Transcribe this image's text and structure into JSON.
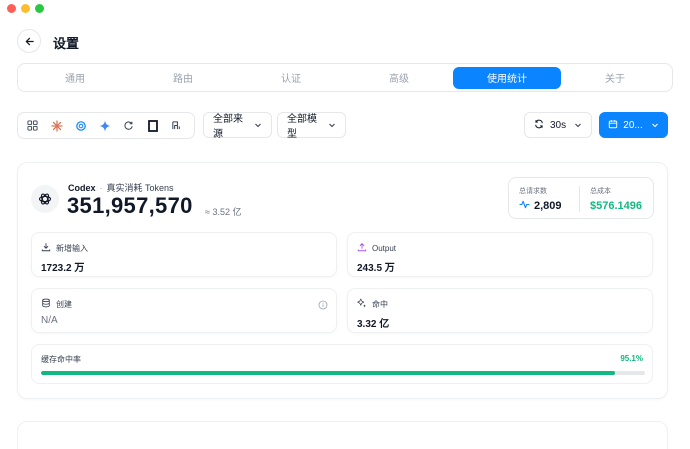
{
  "window": {
    "title": "设置"
  },
  "tabs": [
    {
      "label": "通用",
      "active": false
    },
    {
      "label": "路由",
      "active": false
    },
    {
      "label": "认证",
      "active": false
    },
    {
      "label": "高级",
      "active": false
    },
    {
      "label": "使用统计",
      "active": true
    },
    {
      "label": "关于",
      "active": false
    }
  ],
  "filters": {
    "source_icons": [
      "grid-icon",
      "claude-icon",
      "openai-icon",
      "gemini-icon",
      "refresh-ring-icon",
      "square-logo-icon",
      "pi-icon"
    ],
    "source": "全部来源",
    "model": "全部模型",
    "refresh": "30s",
    "date": "20..."
  },
  "stats": {
    "app_name": "Codex",
    "subtitle": "真实消耗 Tokens",
    "total_tokens": "351,957,570",
    "approx": "≈ 3.52 亿",
    "summary": {
      "requests_label": "总请求数",
      "requests_value": "2,809",
      "cost_label": "总成本",
      "cost_value": "$576.1496"
    },
    "metrics": {
      "input_label": "新增输入",
      "input_value": "1723.2 万",
      "output_label": "Output",
      "output_value": "243.5 万",
      "create_label": "创建",
      "create_value": "N/A",
      "hit_label": "命中",
      "hit_value": "3.32 亿"
    },
    "cache_hit": {
      "label": "缓存命中率",
      "percent_text": "95.1%",
      "fraction": 0.951
    }
  },
  "colors": {
    "accent": "#0a84ff",
    "success": "#10b981"
  }
}
